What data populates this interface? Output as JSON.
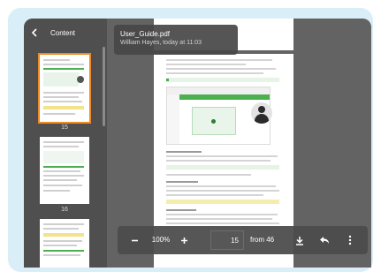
{
  "sidebar": {
    "title": "Content",
    "thumbnails": [
      {
        "label": "15",
        "selected": true
      },
      {
        "label": "16",
        "selected": false
      },
      {
        "label": "",
        "selected": false
      }
    ]
  },
  "file": {
    "name": "User_Guide.pdf",
    "meta": "William Hayes, today at 11:03"
  },
  "toolbar": {
    "zoom": "100%",
    "page": "15",
    "total": "from 46"
  },
  "colors": {
    "frame": "#daeef7",
    "accent_selected": "#f08a24",
    "doc_green": "#4caf50"
  },
  "icons": [
    "chevron-left-icon",
    "minus-icon",
    "plus-icon",
    "download-icon",
    "share-arrow-icon",
    "more-vertical-icon"
  ]
}
